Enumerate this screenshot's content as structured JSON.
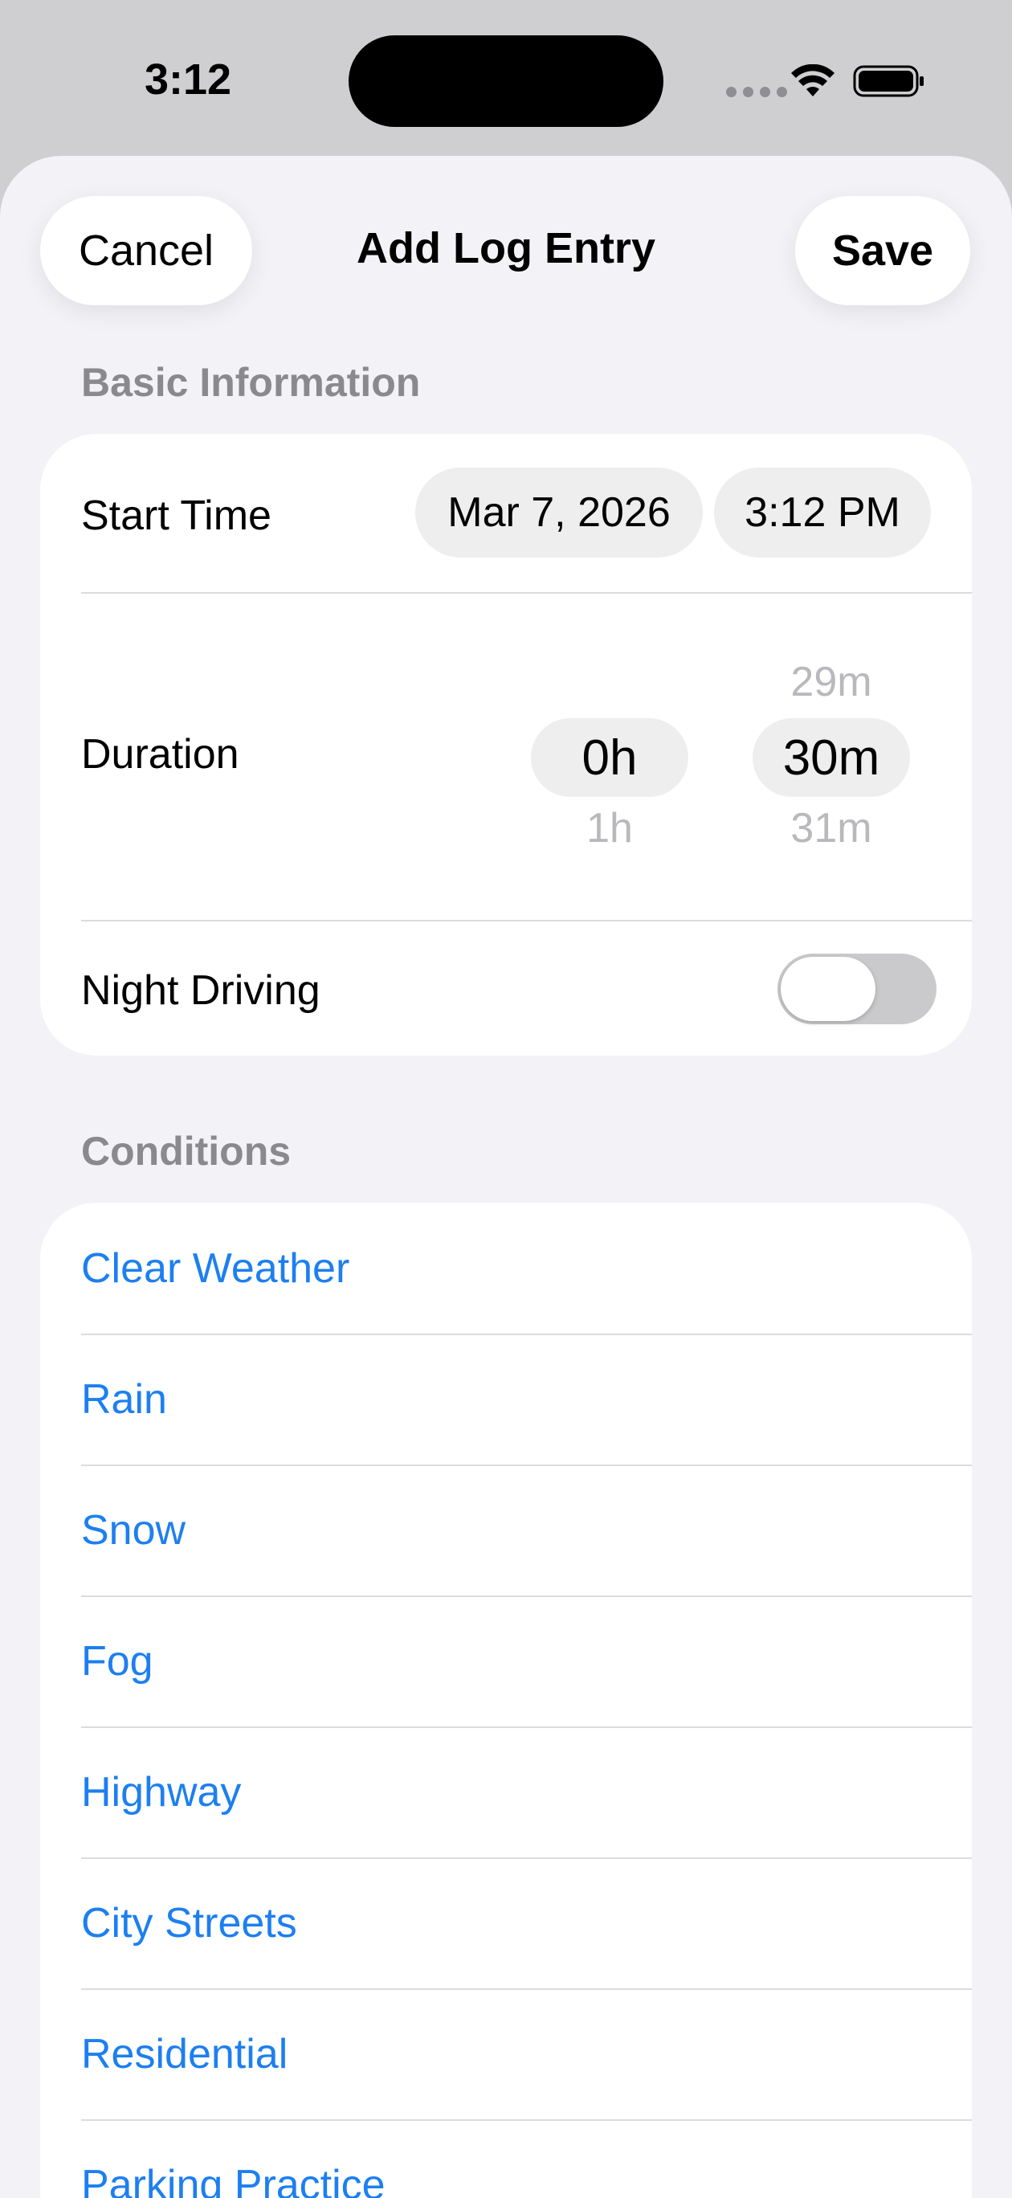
{
  "status_bar": {
    "time": "3:12"
  },
  "sheet": {
    "title": "Add Log Entry",
    "cancel_label": "Cancel",
    "save_label": "Save"
  },
  "basic_info": {
    "header": "Basic Information",
    "start_time": {
      "label": "Start Time",
      "date": "Mar 7, 2026",
      "time": "3:12 PM"
    },
    "duration": {
      "label": "Duration",
      "hours": {
        "above": "",
        "selected": "0h",
        "below": "1h"
      },
      "minutes": {
        "above": "29m",
        "selected": "30m",
        "below": "31m"
      }
    },
    "night_driving": {
      "label": "Night Driving",
      "on": false
    }
  },
  "conditions": {
    "header": "Conditions",
    "items": [
      {
        "label": "Clear Weather"
      },
      {
        "label": "Rain"
      },
      {
        "label": "Snow"
      },
      {
        "label": "Fog"
      },
      {
        "label": "Highway"
      },
      {
        "label": "City Streets"
      },
      {
        "label": "Residential"
      },
      {
        "label": "Parking Practice"
      }
    ]
  },
  "colors": {
    "accent": "#1d7ff0",
    "background": "#f2f2f7",
    "card": "#ffffff"
  }
}
